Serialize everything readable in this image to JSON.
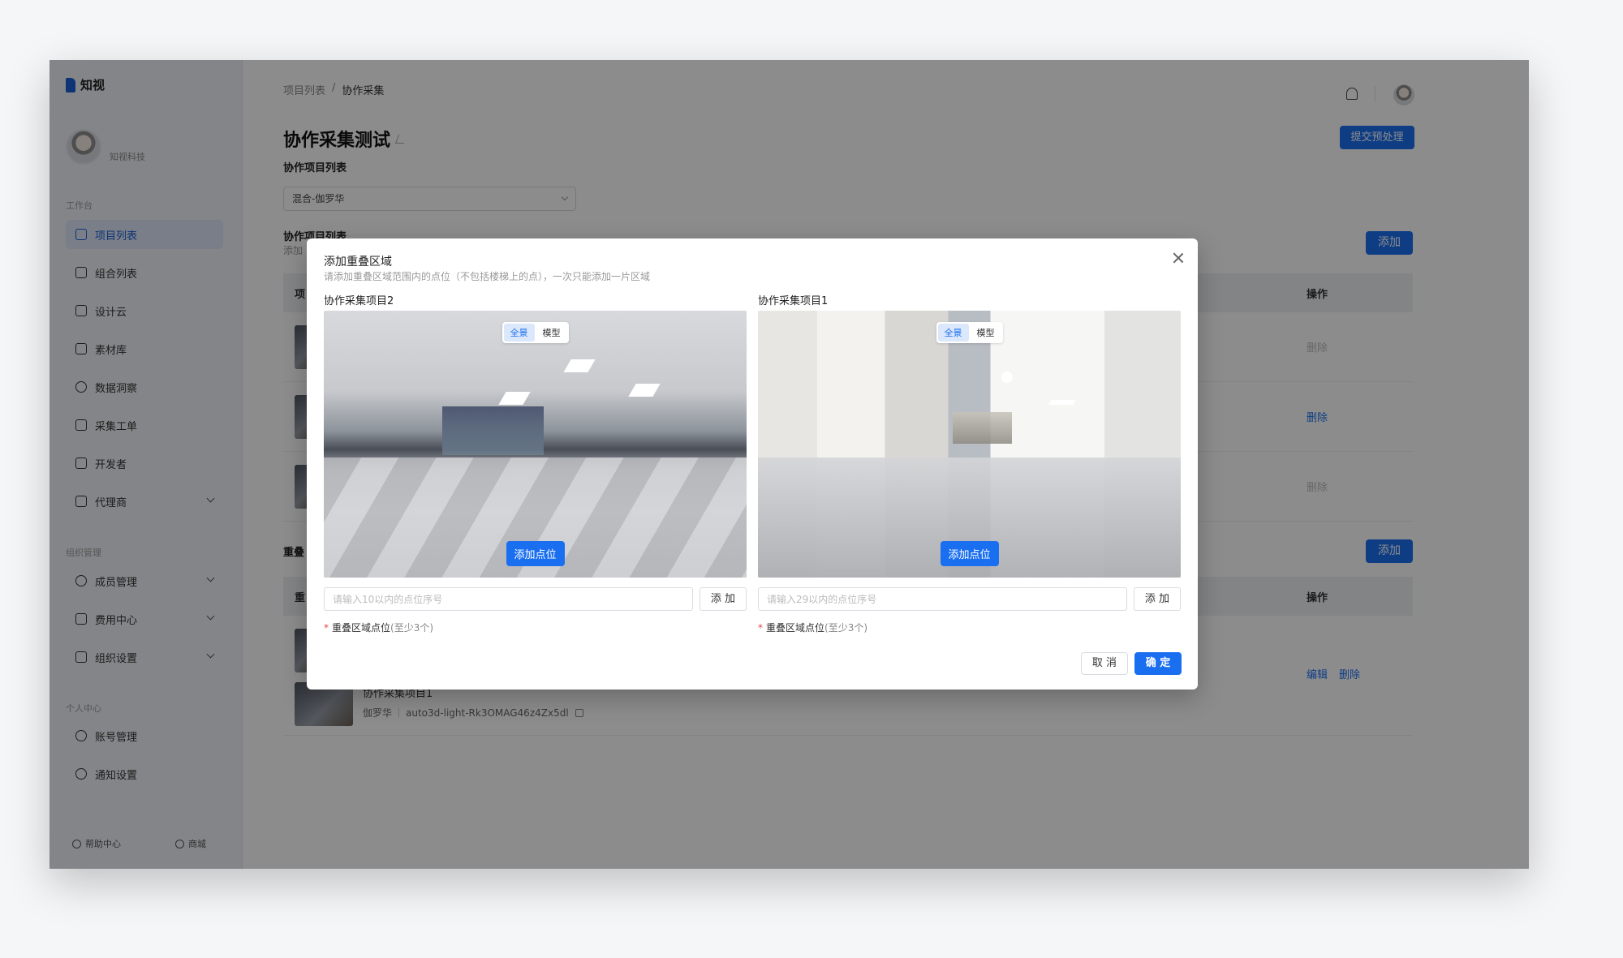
{
  "app": {
    "logo_text": "知视"
  },
  "profile": {
    "name": "知视科技"
  },
  "sidebar": {
    "group_workspace": "工作台",
    "group_org": "组织管理",
    "group_personal": "个人中心",
    "items": [
      {
        "label": "项目列表",
        "icon": "project-icon",
        "active": true
      },
      {
        "label": "组合列表",
        "icon": "layers-icon"
      },
      {
        "label": "设计云",
        "icon": "monitor-icon"
      },
      {
        "label": "素材库",
        "icon": "folder-icon"
      },
      {
        "label": "数据洞察",
        "icon": "chart-icon"
      },
      {
        "label": "采集工单",
        "icon": "ticket-icon"
      },
      {
        "label": "开发者",
        "icon": "code-icon"
      },
      {
        "label": "代理商",
        "icon": "briefcase-icon",
        "expandable": true
      },
      {
        "label": "成员管理",
        "icon": "members-icon",
        "expandable": true
      },
      {
        "label": "费用中心",
        "icon": "wallet-icon",
        "expandable": true
      },
      {
        "label": "组织设置",
        "icon": "shield-icon",
        "expandable": true
      },
      {
        "label": "账号管理",
        "icon": "user-icon"
      },
      {
        "label": "通知设置",
        "icon": "settings-icon"
      }
    ],
    "footer": {
      "help": "帮助中心",
      "shop": "商城"
    }
  },
  "header": {
    "breadcrumb": [
      "项目列表",
      "/",
      "协作采集"
    ],
    "title": "协作采集测试",
    "submit_label": "提交预处理"
  },
  "main": {
    "project_list_label": "协作项目列表",
    "select_value": "混合-伽罗华",
    "section1_label": "协作项目列表",
    "section1_sub": "添加",
    "add_label": "添加",
    "col_first": "项",
    "col_ops": "操作",
    "rows1": [
      {
        "action": "删除",
        "disabled": true
      },
      {
        "action": "删除",
        "disabled": false
      },
      {
        "action": "删除",
        "disabled": true
      }
    ],
    "section2_label": "重叠",
    "col2_first": "重",
    "row2": {
      "name": "协作采集项目1",
      "owner": "伽罗华",
      "id": "auto3d-light-Rk3OMAG46z4Zx5dl",
      "edit": "编辑",
      "delete": "删除"
    }
  },
  "modal": {
    "title": "添加重叠区域",
    "desc": "请添加重叠区域范围内的点位（不包括楼梯上的点），一次只能添加一片区域",
    "panels": [
      {
        "title": "协作采集项目2",
        "toggle": [
          "全景",
          "模型"
        ],
        "add_point": "添加点位",
        "placeholder": "请输入10以内的点位序号",
        "add_btn": "添 加",
        "req_label": "重叠区域点位",
        "req_hint": "(至少3个)"
      },
      {
        "title": "协作采集项目1",
        "toggle": [
          "全景",
          "模型"
        ],
        "add_point": "添加点位",
        "placeholder": "请输入29以内的点位序号",
        "add_btn": "添 加",
        "req_label": "重叠区域点位",
        "req_hint": "(至少3个)"
      }
    ],
    "cancel": "取 消",
    "confirm": "确 定"
  }
}
